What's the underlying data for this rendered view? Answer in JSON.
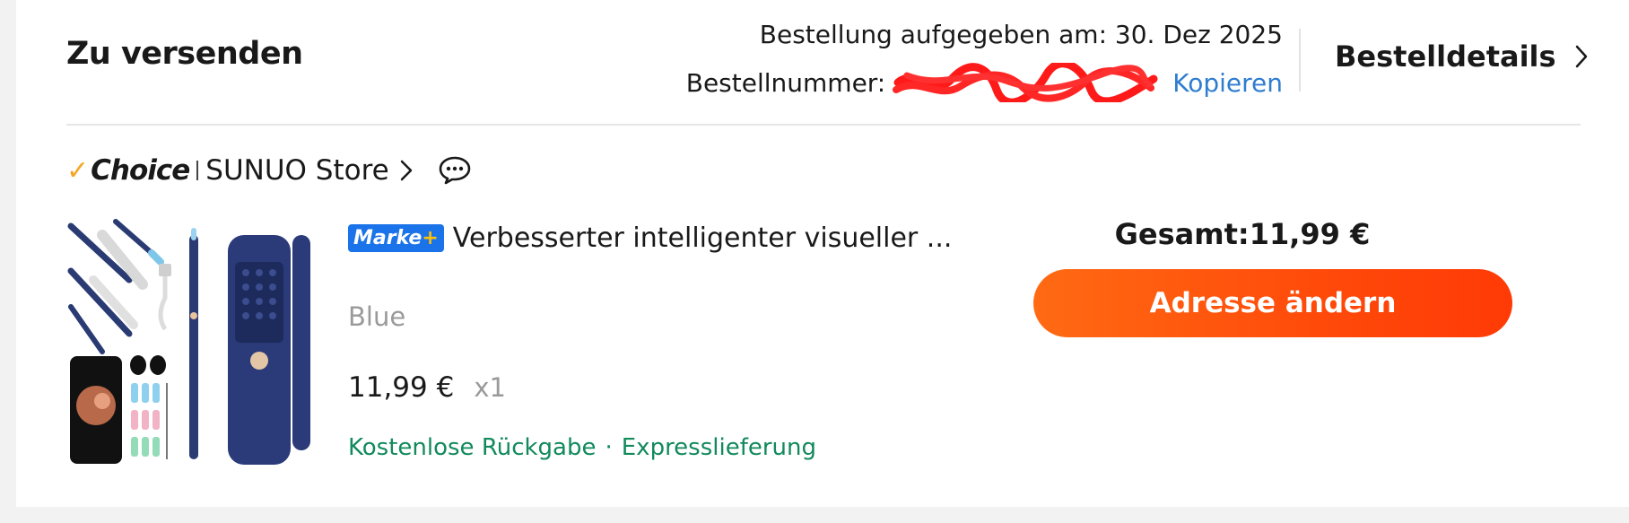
{
  "order": {
    "status_title": "Zu versenden",
    "date_label": "Bestellung aufgegeben am:",
    "date_value": "30. Dez 2025",
    "number_label": "Bestellnummer:",
    "copy_label": "Kopieren",
    "details_label": "Bestelldetails"
  },
  "store": {
    "choice_label": "Choice",
    "name": "SUNUO Store"
  },
  "product": {
    "brand_badge": "Marke",
    "brand_plus": "+",
    "title": "Verbesserter intelligenter visueller ...",
    "variant": "Blue",
    "price": "11,99 €",
    "quantity": "x1",
    "service_1": "Kostenlose Rückgabe",
    "service_separator": "·",
    "service_2": "Expresslieferung"
  },
  "summary": {
    "total_label": "Gesamt:",
    "total_value": "11,99 €",
    "button_label": "Adresse ändern"
  },
  "colors": {
    "accent_orange": "#ff5a0f",
    "link_blue": "#2e7dd1",
    "service_green": "#128a5c",
    "choice_gold": "#f5a623",
    "brand_badge_blue": "#1a73e8"
  }
}
